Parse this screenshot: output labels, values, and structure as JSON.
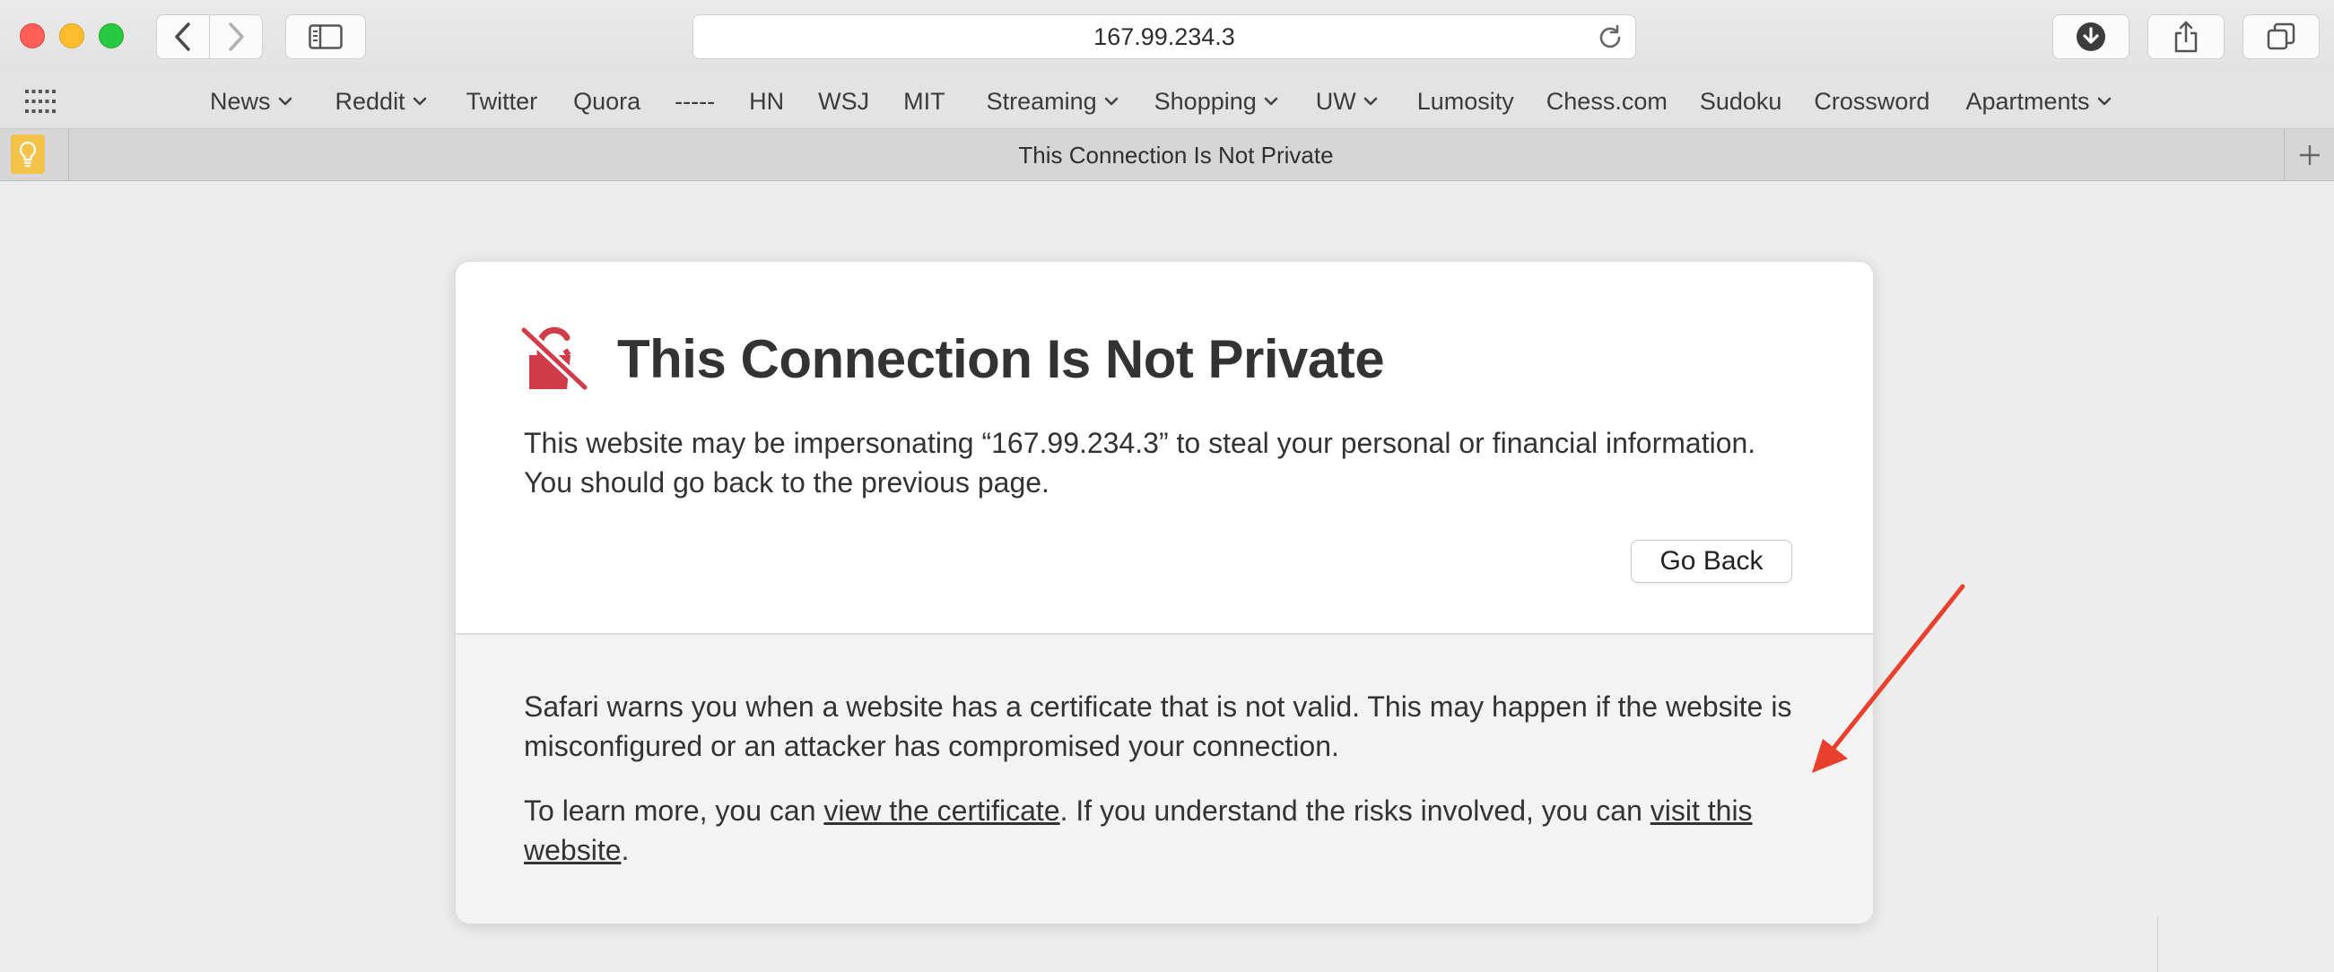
{
  "browser": {
    "url": "167.99.234.3",
    "tab_title": "This Connection Is Not Private"
  },
  "favorites": [
    {
      "label": "News",
      "has_menu": true
    },
    {
      "label": "Reddit",
      "has_menu": true
    },
    {
      "label": "Twitter",
      "has_menu": false
    },
    {
      "label": "Quora",
      "has_menu": false
    },
    {
      "label": "-----",
      "has_menu": false
    },
    {
      "label": "HN",
      "has_menu": false
    },
    {
      "label": "WSJ",
      "has_menu": false
    },
    {
      "label": "MIT",
      "has_menu": false
    },
    {
      "label": "Streaming",
      "has_menu": true
    },
    {
      "label": "Shopping",
      "has_menu": true
    },
    {
      "label": "UW",
      "has_menu": true
    },
    {
      "label": "Lumosity",
      "has_menu": false
    },
    {
      "label": "Chess.com",
      "has_menu": false
    },
    {
      "label": "Sudoku",
      "has_menu": false
    },
    {
      "label": "Crossword",
      "has_menu": false
    },
    {
      "label": "Apartments",
      "has_menu": true
    }
  ],
  "warning": {
    "title": "This Connection Is Not Private",
    "description": "This website may be impersonating “167.99.234.3” to steal your personal or financial information. You should go back to the previous page.",
    "go_back_label": "Go Back",
    "detail_paragraph": "Safari warns you when a website has a certificate that is not valid. This may happen if the website is misconfigured or an attacker has compromised your connection.",
    "learn_more_prefix": "To learn more, you can ",
    "view_certificate_link": "view the certificate",
    "learn_more_middle": ". If you understand the risks involved, you can ",
    "visit_website_link": "visit this website",
    "learn_more_suffix": "."
  },
  "icons": {
    "back": "chevron-left-icon",
    "forward": "chevron-right-icon",
    "sidebar": "sidebar-icon",
    "reload": "reload-icon",
    "download": "download-icon",
    "share": "share-icon",
    "tabs": "tab-overview-icon",
    "favorites_grid": "grid-icon",
    "new_tab": "plus-icon",
    "warning": "broken-lock-icon",
    "favicon": "lightbulb-icon",
    "annotation": "red-arrow-icon"
  },
  "colors": {
    "warning_icon": "#d13c4b",
    "annotation_arrow": "#e8402c",
    "favicon_bg": "#f4c349"
  }
}
